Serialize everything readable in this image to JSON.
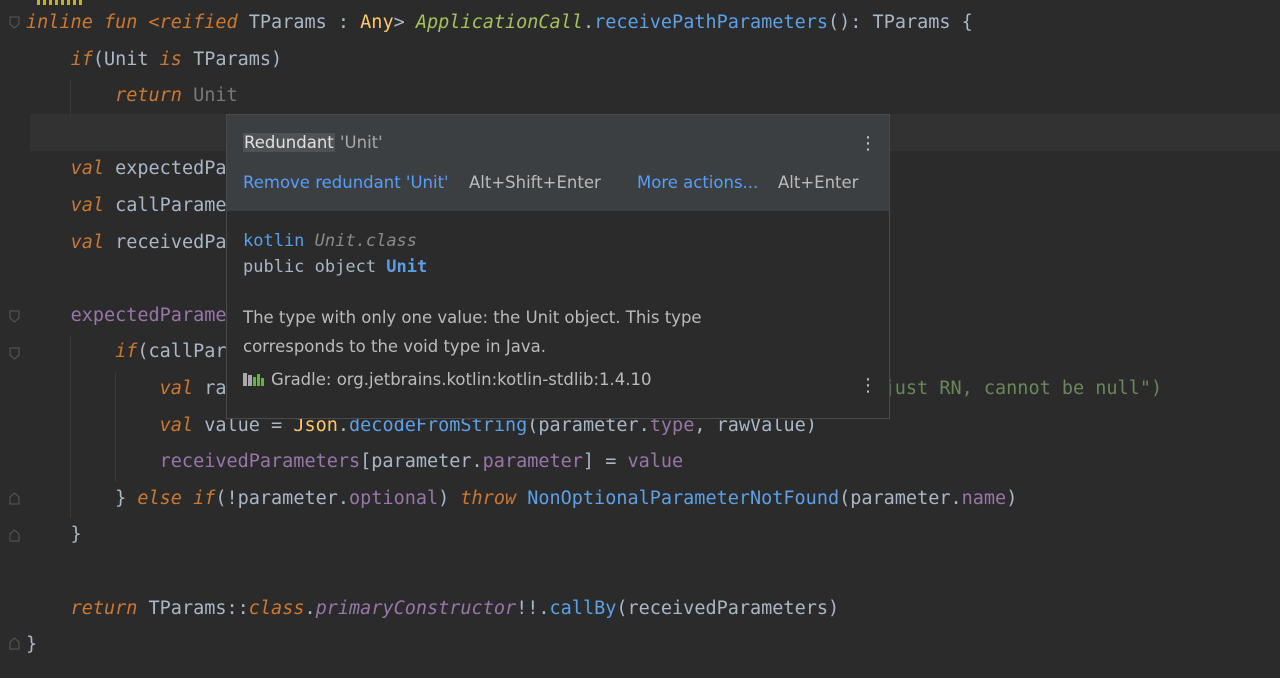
{
  "editor": {
    "lines": [
      {
        "parts": [
          {
            "t": "inline fun ",
            "c": "kwi"
          },
          {
            "t": "<reified ",
            "c": "kwi"
          },
          {
            "t": "TParams ",
            "c": "typ"
          },
          {
            "t": ": ",
            "c": "typ"
          },
          {
            "t": "Any",
            "c": "fn"
          },
          {
            "t": "> ",
            "c": "typ"
          },
          {
            "t": "ApplicationCall",
            "c": "green-it"
          },
          {
            "t": ".",
            "c": "typ"
          },
          {
            "t": "receivePathParameters",
            "c": "blue"
          },
          {
            "t": "(): TParams {",
            "c": "typ"
          }
        ]
      },
      {
        "parts": [
          {
            "t": "    ",
            "c": "typ"
          },
          {
            "t": "if",
            "c": "kwi"
          },
          {
            "t": "(Unit ",
            "c": "typ"
          },
          {
            "t": "is ",
            "c": "kwi"
          },
          {
            "t": "TParams)",
            "c": "typ"
          }
        ]
      },
      {
        "parts": [
          {
            "t": "        ",
            "c": "typ"
          },
          {
            "t": "return ",
            "c": "kwi"
          },
          {
            "t": "Unit",
            "c": "grey"
          }
        ]
      },
      {
        "parts": []
      },
      {
        "parts": [
          {
            "t": "    ",
            "c": "typ"
          },
          {
            "t": "val ",
            "c": "kwi"
          },
          {
            "t": "expectedPa",
            "c": "typ"
          }
        ]
      },
      {
        "parts": [
          {
            "t": "    ",
            "c": "typ"
          },
          {
            "t": "val ",
            "c": "kwi"
          },
          {
            "t": "callParame",
            "c": "typ"
          }
        ]
      },
      {
        "parts": [
          {
            "t": "    ",
            "c": "typ"
          },
          {
            "t": "val ",
            "c": "kwi"
          },
          {
            "t": "receivedPa",
            "c": "typ"
          }
        ]
      },
      {
        "parts": []
      },
      {
        "parts": [
          {
            "t": "    ",
            "c": "typ"
          },
          {
            "t": "expectedParame",
            "c": "prop"
          }
        ]
      },
      {
        "parts": [
          {
            "t": "        ",
            "c": "typ"
          },
          {
            "t": "if",
            "c": "kwi"
          },
          {
            "t": "(callPar",
            "c": "typ"
          }
        ]
      },
      {
        "parts": [
          {
            "t": "            ",
            "c": "typ"
          },
          {
            "t": "val ",
            "c": "kwi"
          },
          {
            "t": "ra",
            "c": "typ"
          },
          {
            "t": "                                                  ",
            "c": "typ"
          },
          {
            "t": "heck was just RN, cannot be null\")",
            "c": "str"
          }
        ]
      },
      {
        "parts": [
          {
            "t": "            ",
            "c": "typ"
          },
          {
            "t": "val ",
            "c": "kwi"
          },
          {
            "t": "value = ",
            "c": "typ"
          },
          {
            "t": "Json",
            "c": "fn"
          },
          {
            "t": ".",
            "c": "typ"
          },
          {
            "t": "decodeFromString",
            "c": "blue"
          },
          {
            "t": "(parameter.",
            "c": "typ"
          },
          {
            "t": "type",
            "c": "prop"
          },
          {
            "t": ", rawValue)",
            "c": "typ"
          }
        ]
      },
      {
        "parts": [
          {
            "t": "            ",
            "c": "typ"
          },
          {
            "t": "receivedParameters",
            "c": "prop"
          },
          {
            "t": "[parameter.",
            "c": "typ"
          },
          {
            "t": "parameter",
            "c": "prop"
          },
          {
            "t": "] = ",
            "c": "typ"
          },
          {
            "t": "value",
            "c": "prop"
          }
        ]
      },
      {
        "parts": [
          {
            "t": "        } ",
            "c": "typ"
          },
          {
            "t": "else if",
            "c": "kwi"
          },
          {
            "t": "(!parameter.",
            "c": "typ"
          },
          {
            "t": "optional",
            "c": "prop"
          },
          {
            "t": ") ",
            "c": "typ"
          },
          {
            "t": "throw ",
            "c": "kwi"
          },
          {
            "t": "NonOptionalParameterNotFound",
            "c": "blue"
          },
          {
            "t": "(parameter.",
            "c": "typ"
          },
          {
            "t": "name",
            "c": "prop"
          },
          {
            "t": ")",
            "c": "typ"
          }
        ]
      },
      {
        "parts": [
          {
            "t": "    }",
            "c": "typ"
          }
        ]
      },
      {
        "parts": []
      },
      {
        "parts": [
          {
            "t": "    ",
            "c": "typ"
          },
          {
            "t": "return ",
            "c": "kwi"
          },
          {
            "t": "TParams::",
            "c": "typ"
          },
          {
            "t": "class",
            "c": "kwi"
          },
          {
            "t": ".",
            "c": "typ"
          },
          {
            "t": "primaryConstructor",
            "c": "ext"
          },
          {
            "t": "!!.",
            "c": "typ"
          },
          {
            "t": "callBy",
            "c": "blue"
          },
          {
            "t": "(receivedParameters)",
            "c": "typ"
          }
        ]
      },
      {
        "parts": [
          {
            "t": "}",
            "c": "typ"
          }
        ]
      }
    ]
  },
  "popup": {
    "inspection_word": "Redundant",
    "inspection_rest": " 'Unit'",
    "fix_label": "Remove redundant 'Unit'",
    "fix_shortcut": "Alt+Shift+Enter",
    "more_label": "More actions...",
    "more_shortcut": "Alt+Enter",
    "doc_pkg": "kotlin",
    "doc_class": "Unit.class",
    "doc_decl": "public object ",
    "doc_name": "Unit",
    "doc_desc_1": "The type with only one value: the Unit object. This type",
    "doc_desc_2": "corresponds to the void type in Java.",
    "library": "Gradle: org.jetbrains.kotlin:kotlin-stdlib:1.4.10",
    "icons": [
      "more-vertical-icon",
      "library-icon"
    ]
  },
  "colors": {
    "background": "#2b2b2b",
    "keyword": "#cc7832",
    "link": "#589df6",
    "string": "#6a8759",
    "property": "#9876aa"
  }
}
